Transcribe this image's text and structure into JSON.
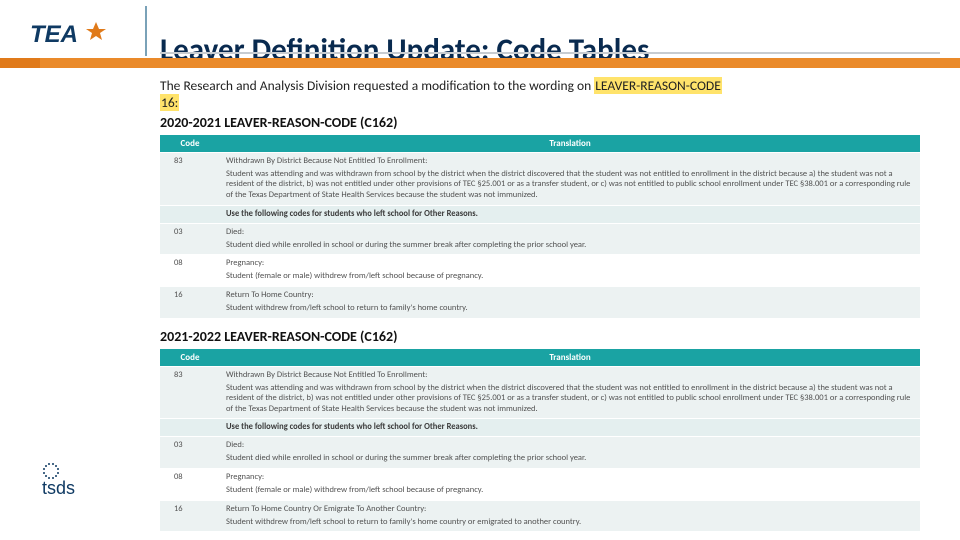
{
  "logo": {
    "tea_text": "TEA",
    "tsds_text": "tsds"
  },
  "title": "Leaver Definition Update: Code Tables",
  "intro": {
    "prefix": "The Research and Analysis Division requested a modification to the wording on ",
    "highlight1": "LEAVER-REASON-CODE",
    "highlight2": "16:"
  },
  "blocks": [
    {
      "heading": "2020-2021 LEAVER-REASON-CODE (C162)",
      "columns": {
        "code": "Code",
        "translation": "Translation"
      },
      "rows": [
        {
          "code": "83",
          "title": "Withdrawn By District Because Not Entitled To Enrollment:",
          "body": "Student was attending and was withdrawn from school by the district when the district discovered that the student was not entitled to enrollment in the district because a) the student was not a resident of the district, b) was not entitled under other provisions of TEC §25.001 or as a transfer student, or c) was not entitled to public school enrollment under TEC §38.001 or a corresponding rule of the Texas Department of State Health Services because the student was not immunized."
        },
        {
          "separator": true,
          "label": "Use the following codes for students who left school for Other Reasons."
        },
        {
          "code": "03",
          "title": "Died:",
          "body": "Student died while enrolled in school or during the summer break after completing the prior school year."
        },
        {
          "code": "08",
          "title": "Pregnancy:",
          "body": "Student (female or male) withdrew from/left school because of pregnancy."
        },
        {
          "code": "16",
          "title": "Return To Home Country:",
          "body": "Student withdrew from/left school to return to family's home country."
        }
      ]
    },
    {
      "heading": "2021-2022 LEAVER-REASON-CODE (C162)",
      "columns": {
        "code": "Code",
        "translation": "Translation"
      },
      "rows": [
        {
          "code": "83",
          "title": "Withdrawn By District Because Not Entitled To Enrollment:",
          "body": "Student was attending and was withdrawn from school by the district when the district discovered that the student was not entitled to enrollment in the district because a) the student was not a resident of the district, b) was not entitled under other provisions of TEC §25.001 or as a transfer student, or c) was not entitled to public school enrollment under TEC §38.001 or a corresponding rule of the Texas Department of State Health Services because the student was not immunized."
        },
        {
          "separator": true,
          "label": "Use the following codes for students who left school for Other Reasons."
        },
        {
          "code": "03",
          "title": "Died:",
          "body": "Student died while enrolled in school or during the summer break after completing the prior school year."
        },
        {
          "code": "08",
          "title": "Pregnancy:",
          "body": "Student (female or male) withdrew from/left school because of pregnancy."
        },
        {
          "code": "16",
          "title": "Return To Home Country Or Emigrate To Another Country:",
          "body": "Student withdrew from/left school to return to family's home country or emigrated to another country."
        }
      ]
    }
  ]
}
